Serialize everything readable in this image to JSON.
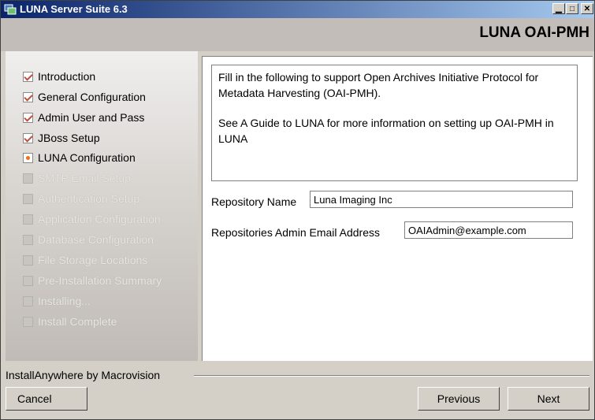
{
  "window": {
    "title": "LUNA Server Suite 6.3",
    "controls": {
      "minimize": "▁",
      "maximize": "□",
      "close": "✕"
    }
  },
  "header": {
    "title": "LUNA OAI-PMH"
  },
  "steps": [
    {
      "label": "Introduction",
      "state": "done"
    },
    {
      "label": "General Configuration",
      "state": "done"
    },
    {
      "label": "Admin User and Pass",
      "state": "done"
    },
    {
      "label": "JBoss Setup",
      "state": "done"
    },
    {
      "label": "LUNA Configuration",
      "state": "current"
    },
    {
      "label": "SMTP Email Setup",
      "state": "todo"
    },
    {
      "label": "Authentication Setup",
      "state": "todo"
    },
    {
      "label": "Application Configuration",
      "state": "todo"
    },
    {
      "label": "Database Configuration",
      "state": "todo"
    },
    {
      "label": "File Storage Locations",
      "state": "todo"
    },
    {
      "label": "Pre-Installation Summary",
      "state": "todo"
    },
    {
      "label": "Installing...",
      "state": "todo"
    },
    {
      "label": "Install Complete",
      "state": "todo"
    }
  ],
  "content": {
    "intro_p1": "Fill in the following to support Open Archives Initiative Protocol for Metadata Harvesting (OAI-PMH).",
    "intro_p2": "See A Guide to LUNA for more information on setting up OAI-PMH in LUNA",
    "repository_name_label": "Repository Name",
    "repository_name_value": "Luna Imaging Inc",
    "admin_email_label": "Repositories Admin Email Address",
    "admin_email_value": "OAIAdmin@example.com"
  },
  "footer": {
    "vendor": "InstallAnywhere by Macrovision",
    "cancel": "Cancel",
    "previous": "Previous",
    "next": "Next"
  },
  "colors": {
    "check": "#c0503a",
    "current": "#f07020",
    "titlebar_start": "#0a246a",
    "titlebar_end": "#a6caf0"
  }
}
